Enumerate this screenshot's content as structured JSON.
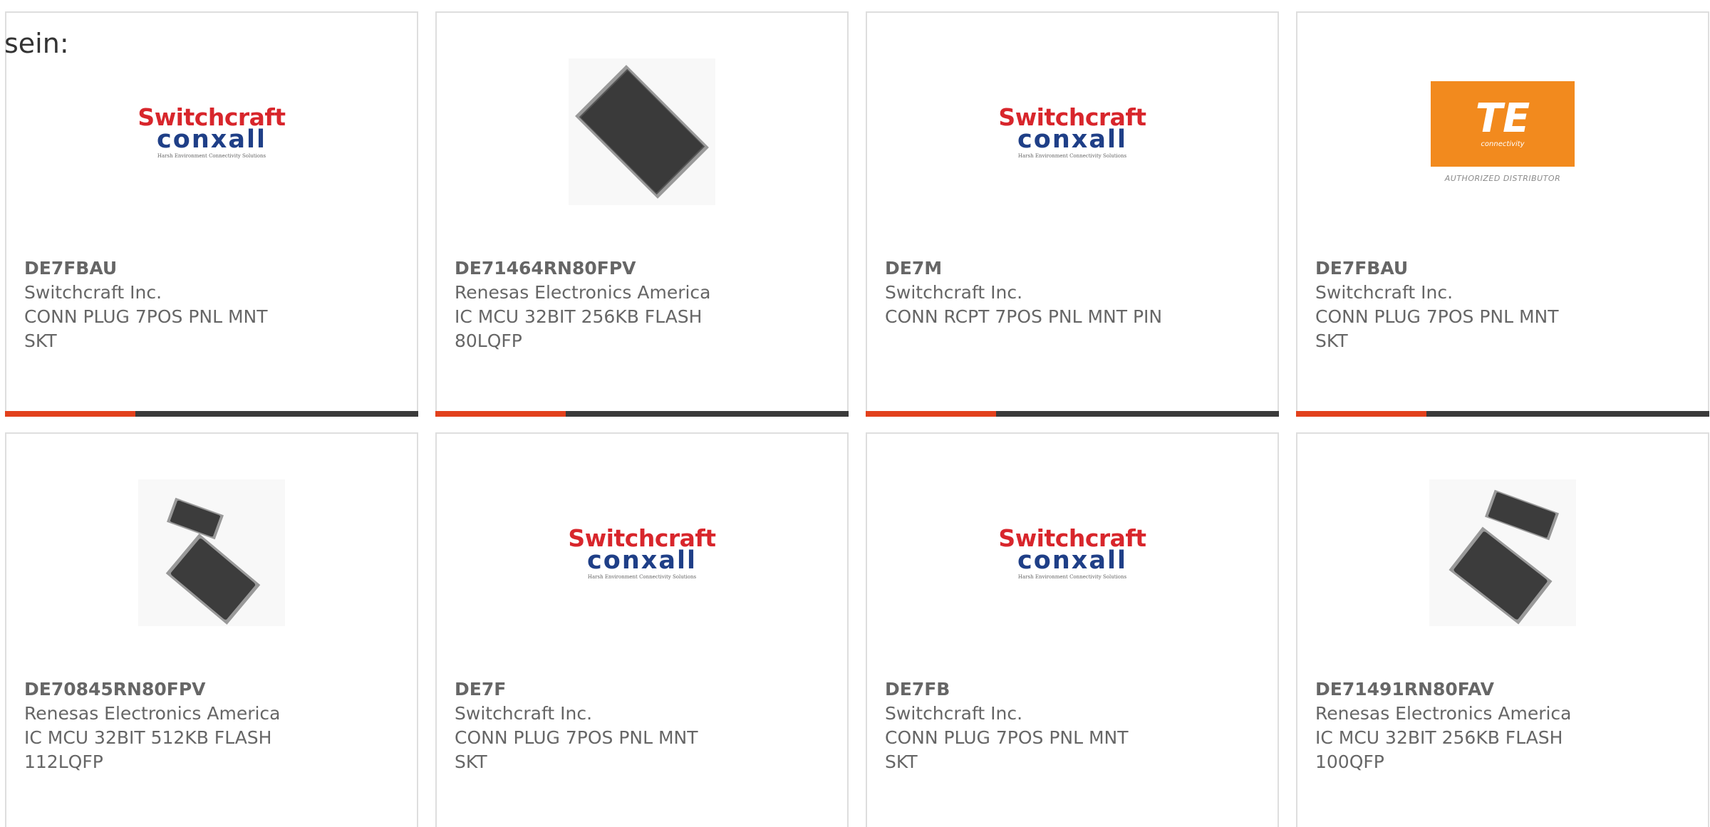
{
  "intro_text": "sein:",
  "colors": {
    "accent": "#e2401c",
    "bar": "#3a3a3a",
    "text": "#666666",
    "border": "#dedede"
  },
  "logos": {
    "switchcraft": {
      "top": "Switchcraft",
      "middle": "conxall",
      "bottom": "Harsh Environment Connectivity Solutions"
    },
    "te": {
      "main": "TE",
      "sub": "connectivity",
      "caption": "AUTHORIZED DISTRIBUTOR"
    }
  },
  "products": [
    {
      "part_number": "DE7FBAU",
      "manufacturer": "Switchcraft Inc.",
      "description": "CONN PLUG 7POS PNL MNT SKT",
      "image": "switchcraft-logo"
    },
    {
      "part_number": "DE71464RN80FPV",
      "manufacturer": "Renesas Electronics America",
      "description": "IC MCU 32BIT 256KB FLASH 80LQFP",
      "image": "chip-qfp-single"
    },
    {
      "part_number": "DE7M",
      "manufacturer": "Switchcraft Inc.",
      "description": "CONN RCPT 7POS PNL MNT PIN",
      "image": "switchcraft-logo"
    },
    {
      "part_number": "DE7FBAU",
      "manufacturer": "Switchcraft Inc.",
      "description": "CONN PLUG 7POS PNL MNT SKT",
      "image": "te-logo"
    },
    {
      "part_number": "DE70845RN80FPV",
      "manufacturer": "Renesas Electronics America",
      "description": "IC MCU 32BIT 512KB FLASH 112LQFP",
      "image": "chip-qfp-double"
    },
    {
      "part_number": "DE7F",
      "manufacturer": "Switchcraft Inc.",
      "description": "CONN PLUG 7POS PNL MNT SKT",
      "image": "switchcraft-logo"
    },
    {
      "part_number": "DE7FB",
      "manufacturer": "Switchcraft Inc.",
      "description": "CONN PLUG 7POS PNL MNT SKT",
      "image": "switchcraft-logo"
    },
    {
      "part_number": "DE71491RN80FAV",
      "manufacturer": "Renesas Electronics America",
      "description": "IC MCU 32BIT 256KB FLASH 100QFP",
      "image": "chip-qfp-double"
    }
  ]
}
